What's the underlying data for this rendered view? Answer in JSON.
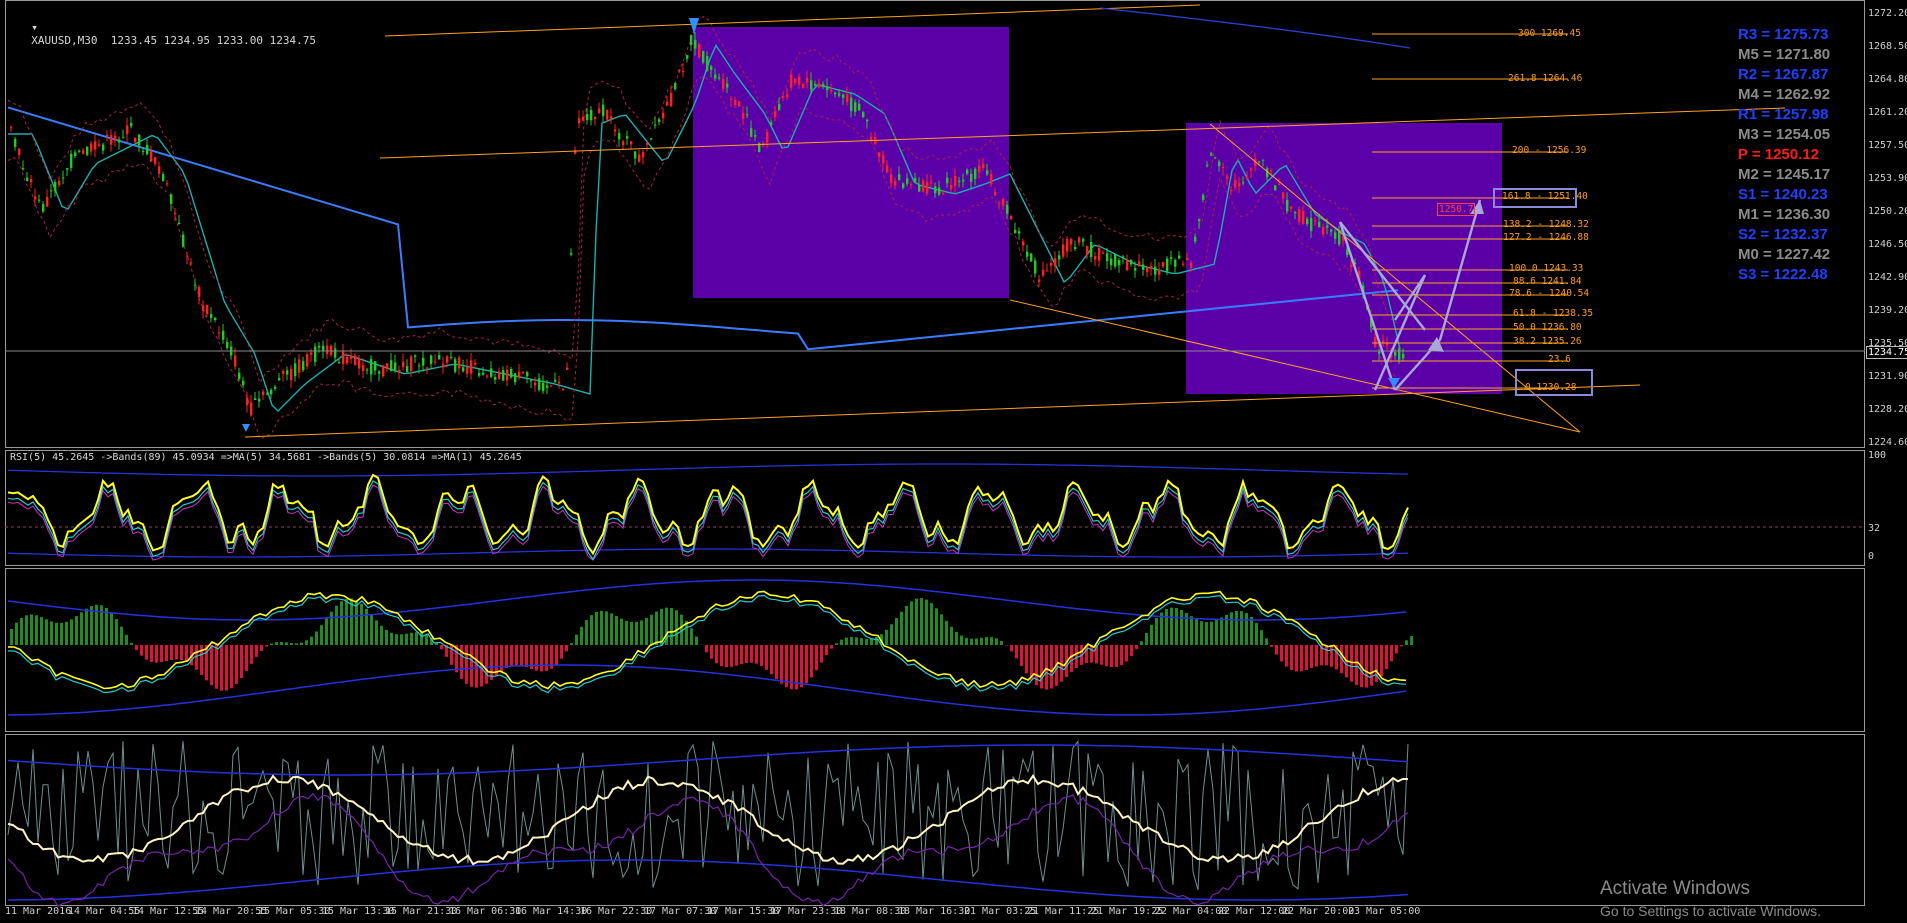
{
  "window": {
    "symbol_info": "XAUUSD,M30  1233.45 1234.95 1233.00 1234.75",
    "menu_icon": "triangle-down-icon"
  },
  "price_scale": [
    "1272.20",
    "1268.50",
    "1264.80",
    "1261.20",
    "1257.50",
    "1253.90",
    "1250.20",
    "1246.50",
    "1242.90",
    "1239.20",
    "1235.50",
    "1231.90",
    "1228.20",
    "1224.60"
  ],
  "current_price": "1234.75",
  "pivots": [
    {
      "label": "R3 = 1275.73",
      "color": "#1f3fff"
    },
    {
      "label": "M5 = 1271.80",
      "color": "#8c8c8c"
    },
    {
      "label": "R2 = 1267.87",
      "color": "#1f3fff"
    },
    {
      "label": "M4 = 1262.92",
      "color": "#8c8c8c"
    },
    {
      "label": "R1 = 1257.98",
      "color": "#1f3fff"
    },
    {
      "label": "M3 = 1254.05",
      "color": "#8c8c8c"
    },
    {
      "label": "P  = 1250.12",
      "color": "#ff1a1a"
    },
    {
      "label": "M2 = 1245.17",
      "color": "#8c8c8c"
    },
    {
      "label": "S1 = 1240.23",
      "color": "#1f3fff"
    },
    {
      "label": "M1 = 1236.30",
      "color": "#8c8c8c"
    },
    {
      "label": "S2 = 1232.37",
      "color": "#1f3fff"
    },
    {
      "label": "M0 = 1227.42",
      "color": "#8c8c8c"
    },
    {
      "label": "S3 = 1222.48",
      "color": "#1f3fff"
    }
  ],
  "fib_levels": [
    {
      "label": "300 1269.45"
    },
    {
      "label": "261.8 1264.46"
    },
    {
      "label": "200 - 1256.39"
    },
    {
      "label": "161.8 - 1251.40"
    },
    {
      "label": "138.2 - 1248.32"
    },
    {
      "label": "127.2 - 1246.88"
    },
    {
      "label": "100.0 1243.33"
    },
    {
      "label": "88.6 1241.84"
    },
    {
      "label": "78.6 - 1240.54"
    },
    {
      "label": "61.8 - 1238.35"
    },
    {
      "label": "50.0 1236.80"
    },
    {
      "label": "38.2 1235.26"
    },
    {
      "label": "23.6"
    },
    {
      "label": "0 1230.28"
    }
  ],
  "small_red_label": "1250.7",
  "rsi_panel": {
    "label": "RSI(5) 45.2645  ->Bands(89) 45.0934  =>MA(5) 34.5681  ->Bands(5) 30.0814  =>MA(1) 45.2645",
    "scale": [
      "100",
      "32",
      "0"
    ]
  },
  "time_axis": [
    "11 Mar 2016",
    "14 Mar 04:55",
    "14 Mar 12:55",
    "14 Mar 20:55",
    "15 Mar 05:30",
    "15 Mar 13:30",
    "15 Mar 21:30",
    "16 Mar 06:30",
    "16 Mar 14:30",
    "16 Mar 22:30",
    "17 Mar 07:30",
    "17 Mar 15:30",
    "17 Mar 23:30",
    "18 Mar 08:30",
    "18 Mar 16:30",
    "21 Mar 03:25",
    "21 Mar 11:25",
    "21 Mar 19:25",
    "22 Mar 04:00",
    "22 Mar 12:00",
    "22 Mar 20:00",
    "23 Mar 05:00"
  ],
  "watermark": {
    "title": "Activate Windows",
    "subtitle": "Go to Settings to activate Windows."
  },
  "colors": {
    "zone_purple": "#5b00a8",
    "orange_line": "#ffa21f",
    "blue_ma": "#3b7cff",
    "teal_ma": "#1ab0b0",
    "bull": "#22cc22",
    "bear": "#ff2020",
    "hist_green": "#228b22",
    "hist_red": "#dc143c"
  }
}
